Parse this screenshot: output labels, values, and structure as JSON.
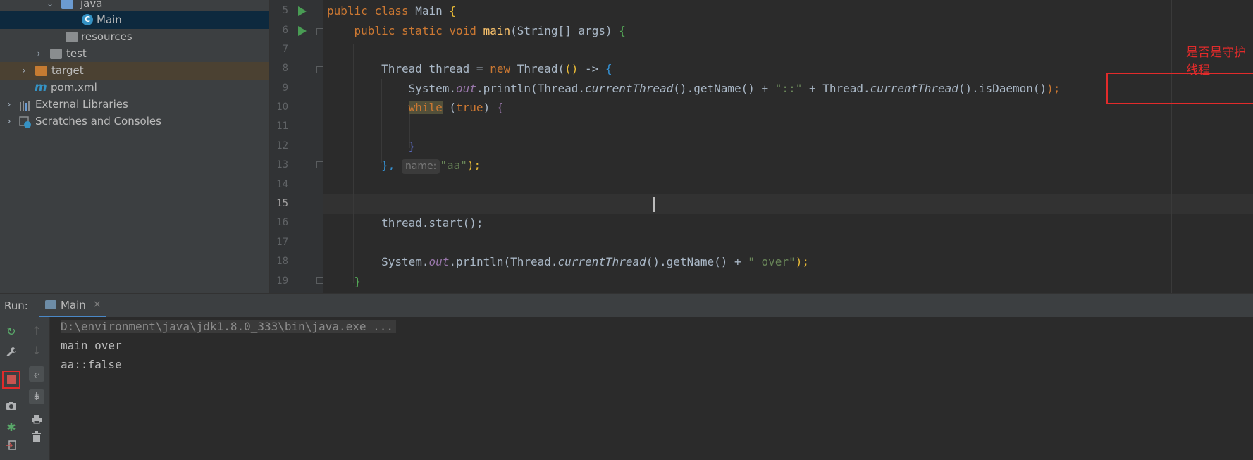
{
  "project_tree": {
    "items": [
      {
        "label": "java",
        "icon": "folder-blue-icon",
        "expanded": true
      },
      {
        "label": "Main",
        "icon": "java-class-icon",
        "selected": true
      },
      {
        "label": "resources",
        "icon": "resources-folder-icon"
      },
      {
        "label": "test",
        "icon": "folder-icon",
        "collapsed": true
      },
      {
        "label": "target",
        "icon": "folder-excluded-icon",
        "collapsed": true
      },
      {
        "label": "pom.xml",
        "icon": "maven-icon"
      },
      {
        "label": "External Libraries",
        "icon": "libraries-icon",
        "collapsed": true
      },
      {
        "label": "Scratches and Consoles",
        "icon": "scratches-icon",
        "collapsed": true
      }
    ]
  },
  "editor": {
    "line_numbers": [
      "5",
      "6",
      "7",
      "8",
      "9",
      "10",
      "11",
      "12",
      "13",
      "14",
      "15",
      "16",
      "17",
      "18",
      "19"
    ],
    "current_line": "15",
    "code": {
      "l5": {
        "kw1": "public",
        "kw2": "class",
        "name": "Main",
        "brace": "{"
      },
      "l6": {
        "kw1": "public",
        "kw2": "static",
        "kw3": "void",
        "fn": "main",
        "params": "(String[] args)",
        "brace": "{"
      },
      "l8": {
        "pre": "Thread thread = ",
        "kw": "new",
        "call": " Thread(",
        "paren": "()",
        "arrow": " -> ",
        "brace": "{"
      },
      "l9": {
        "a": "System.",
        "out": "out",
        "b": ".println(Thread.",
        "ct": "currentThread",
        "c": "().getName() + ",
        "sep": "\"::\"",
        "d": " + ",
        "e": "Thread.",
        "ct2": "currentThread",
        "f": "().isDaemon()",
        "g": ");"
      },
      "l10": {
        "kw": "while",
        "rest1": " (",
        "val": "true",
        "rest2": ") ",
        "brace": "{"
      },
      "l12": {
        "brace": "}"
      },
      "l13": {
        "pre": "}, ",
        "hint": "name:",
        "str": "\"aa\"",
        "post": ");"
      },
      "l16": {
        "text": "thread.start();"
      },
      "l18": {
        "a": "System.",
        "out": "out",
        "b": ".println(Thread.",
        "ct": "currentThread",
        "c": "().getName() + ",
        "str": "\" over\"",
        "d": ");"
      },
      "l19": {
        "brace": "}"
      }
    }
  },
  "annotation": {
    "text": "是否是守护线程",
    "color": "#e22b2b"
  },
  "run_panel": {
    "label": "Run:",
    "tab_label": "Main",
    "tab_close": "×",
    "console_lines": [
      "D:\\environment\\java\\jdk1.8.0_333\\bin\\java.exe ...",
      "main over",
      "aa::false"
    ]
  },
  "colors": {
    "keyword": "#cc7832",
    "method": "#ffc66d",
    "static_field": "#9876aa",
    "string": "#6a8759",
    "highlight_red": "#e22b2b"
  }
}
